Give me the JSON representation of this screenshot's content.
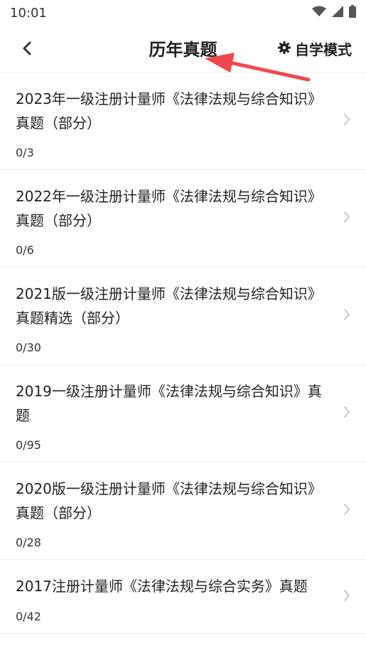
{
  "status": {
    "time": "10:01",
    "icons": [
      "wifi-icon",
      "signal-icon",
      "battery-icon"
    ]
  },
  "header": {
    "title": "历年真题",
    "mode_label": "自学模式",
    "icons": {
      "back": "back-chevron-icon",
      "mode": "gear-icon"
    }
  },
  "items": [
    {
      "title": "2023年一级注册计量师《法律法规与综合知识》真题（部分）",
      "progress": "0/3"
    },
    {
      "title": "2022年一级注册计量师《法律法规与综合知识》真题（部分）",
      "progress": "0/6"
    },
    {
      "title": "2021版一级注册计量师《法律法规与综合知识》真题精选（部分）",
      "progress": "0/30"
    },
    {
      "title": "2019一级注册计量师《法律法规与综合知识》真题",
      "progress": "0/95"
    },
    {
      "title": "2020版一级注册计量师《法律法规与综合知识》真题（部分）",
      "progress": "0/28"
    },
    {
      "title": "2017注册计量师《法律法规与综合实务》真题",
      "progress": "0/42"
    }
  ],
  "colors": {
    "annotation_arrow": "#f0484e",
    "divider": "#ececec",
    "chevron": "#c8c8c8"
  }
}
